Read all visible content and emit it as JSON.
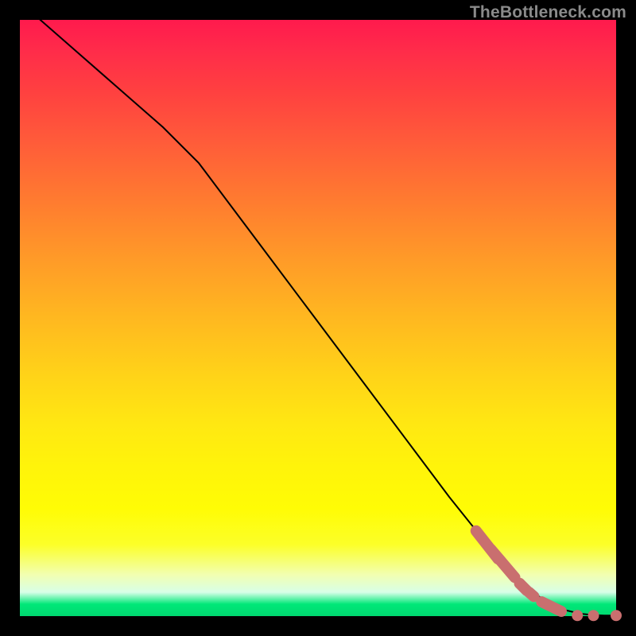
{
  "watermark": "TheBottleneck.com",
  "chart_data": {
    "type": "line",
    "title": "",
    "xlabel": "",
    "ylabel": "",
    "xlim": [
      0,
      100
    ],
    "ylim": [
      0,
      100
    ],
    "grid": false,
    "series": [
      {
        "name": "curve",
        "x": [
          0,
          8,
          16,
          24,
          30,
          36,
          42,
          48,
          54,
          60,
          66,
          72,
          76,
          80,
          83,
          86,
          89,
          91.5,
          94,
          96,
          98,
          100
        ],
        "y": [
          103,
          96,
          89,
          82,
          76,
          68,
          60,
          52,
          44,
          36,
          28,
          20,
          15,
          10,
          6.5,
          4,
          2,
          1,
          0.4,
          0.2,
          0.1,
          0.1
        ]
      }
    ],
    "highlight_segments": [
      {
        "x1": 76.5,
        "y1": 14.3,
        "x2": 80.2,
        "y2": 9.6
      },
      {
        "x1": 79.0,
        "y1": 11.2,
        "x2": 83.0,
        "y2": 6.5
      },
      {
        "x1": 83.8,
        "y1": 5.5,
        "x2": 85.0,
        "y2": 4.3
      },
      {
        "x1": 85.4,
        "y1": 4.0,
        "x2": 86.2,
        "y2": 3.3
      },
      {
        "x1": 87.5,
        "y1": 2.4,
        "x2": 90.8,
        "y2": 0.8
      }
    ],
    "markers": [
      {
        "x": 93.5,
        "y": 0.1
      },
      {
        "x": 96.2,
        "y": 0.1
      },
      {
        "x": 100.0,
        "y": 0.1
      }
    ],
    "colors": {
      "line": "#000000",
      "marker": "#c96f6f",
      "background_top": "#ff1a4d",
      "background_bottom": "#00d870"
    }
  }
}
